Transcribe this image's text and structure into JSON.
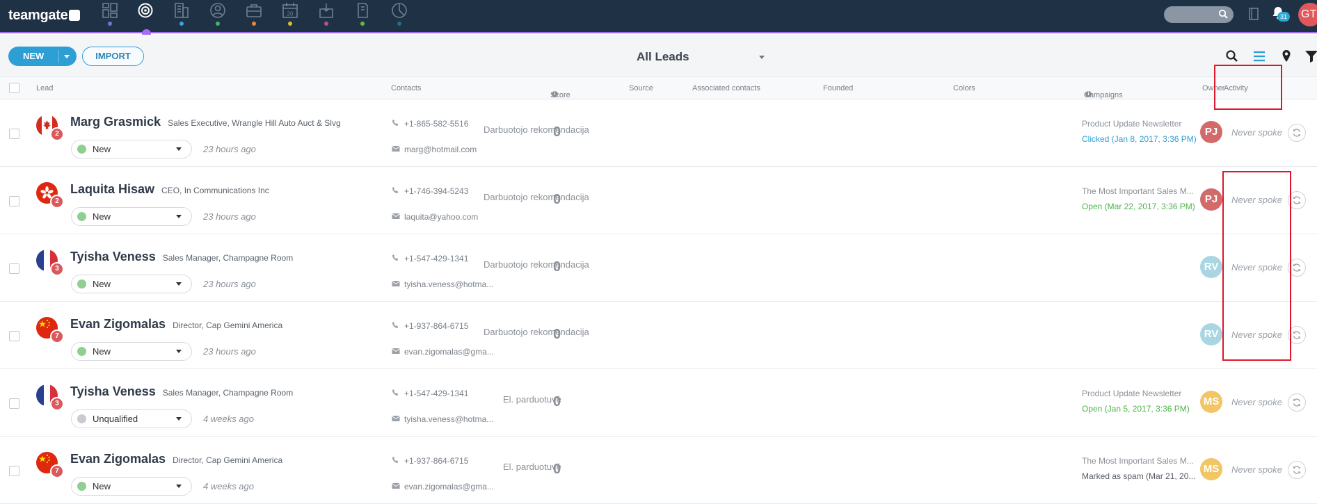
{
  "app": {
    "logo_text": "teamgate",
    "nav_items": [
      {
        "icon": "dashboard-icon",
        "dot_color": "#6a78d8"
      },
      {
        "icon": "leads-target-icon",
        "dot_color": "#a86cf2",
        "active": true
      },
      {
        "icon": "companies-building-icon",
        "dot_color": "#3aa5d8"
      },
      {
        "icon": "contacts-person-icon",
        "dot_color": "#43b36b"
      },
      {
        "icon": "deals-briefcase-icon",
        "dot_color": "#e8863a"
      },
      {
        "icon": "calendar-icon",
        "calendar_day": "20",
        "dot_color": "#d6c12a"
      },
      {
        "icon": "tasks-inbox-icon",
        "dot_color": "#c14e8a"
      },
      {
        "icon": "documents-icon",
        "dot_color": "#6ab83e"
      },
      {
        "icon": "reports-pie-icon",
        "dot_color": "#2a6a8a"
      }
    ],
    "notifications_count": "31",
    "user_initials": "GT"
  },
  "toolbar": {
    "new_label": "NEW",
    "import_label": "IMPORT",
    "view_label": "All Leads"
  },
  "columns": {
    "lead": "Lead",
    "contacts": "Contacts",
    "score": "Score",
    "source": "Source",
    "associated_contacts": "Associated contacts",
    "founded": "Founded",
    "colors": "Colors",
    "campaigns": "Campaigns",
    "owner": "Owner",
    "activity": "Activity"
  },
  "rows": [
    {
      "flag": "canada",
      "badge": "2",
      "name": "Marg Grasmick",
      "title": "Sales Executive, Wrangle Hill Auto Auct & Slvg",
      "status": "New",
      "status_color": "#8fd08f",
      "updated": "23 hours ago",
      "phone": "+1-865-582-5516",
      "email": "marg@hotmail.com",
      "score": "0",
      "source": "Darbuotojo rekomendacija",
      "campaign_name": "Product Update Newsletter",
      "campaign_status": "Clicked (Jan 8, 2017, 3:36 PM)",
      "campaign_color": "#2d9fd4",
      "owner": "PJ",
      "owner_color": "#d36a6a",
      "activity": "Never spoke"
    },
    {
      "flag": "hongkong",
      "badge": "2",
      "name": "Laquita Hisaw",
      "title": "CEO, In Communications Inc",
      "status": "New",
      "status_color": "#8fd08f",
      "updated": "23 hours ago",
      "phone": "+1-746-394-5243",
      "email": "laquita@yahoo.com",
      "score": "0",
      "source": "Darbuotojo rekomendacija",
      "campaign_name": "The Most Important Sales M...",
      "campaign_status": "Open (Mar 22, 2017, 3:36 PM)",
      "campaign_color": "#4cb34c",
      "owner": "PJ",
      "owner_color": "#d36a6a",
      "activity": "Never spoke"
    },
    {
      "flag": "france",
      "badge": "3",
      "name": "Tyisha Veness",
      "title": "Sales Manager, Champagne Room",
      "status": "New",
      "status_color": "#8fd08f",
      "updated": "23 hours ago",
      "phone": "+1-547-429-1341",
      "email": "tyisha.veness@hotma...",
      "score": "0",
      "source": "Darbuotojo rekomendacija",
      "campaign_name": "",
      "campaign_status": "",
      "campaign_color": "#8a9098",
      "owner": "RV",
      "owner_color": "#a9d6e2",
      "activity": "Never spoke"
    },
    {
      "flag": "china",
      "badge": "7",
      "name": "Evan Zigomalas",
      "title": "Director, Cap Gemini America",
      "status": "New",
      "status_color": "#8fd08f",
      "updated": "23 hours ago",
      "phone": "+1-937-864-6715",
      "email": "evan.zigomalas@gma...",
      "score": "0",
      "source": "Darbuotojo rekomendacija",
      "campaign_name": "",
      "campaign_status": "",
      "campaign_color": "#8a9098",
      "owner": "RV",
      "owner_color": "#a9d6e2",
      "activity": "Never spoke"
    },
    {
      "flag": "france",
      "badge": "3",
      "name": "Tyisha Veness",
      "title": "Sales Manager, Champagne Room",
      "status": "Unqualified",
      "status_color": "#c8cbcf",
      "updated": "4 weeks ago",
      "phone": "+1-547-429-1341",
      "email": "tyisha.veness@hotma...",
      "score": "0",
      "source": "El. parduotuvė",
      "campaign_name": "Product Update Newsletter",
      "campaign_status": "Open (Jan 5, 2017, 3:36 PM)",
      "campaign_color": "#4cb34c",
      "owner": "MS",
      "owner_color": "#f2c565",
      "activity": "Never spoke"
    },
    {
      "flag": "china",
      "badge": "7",
      "name": "Evan Zigomalas",
      "title": "Director, Cap Gemini America",
      "status": "New",
      "status_color": "#8fd08f",
      "updated": "4 weeks ago",
      "phone": "+1-937-864-6715",
      "email": "evan.zigomalas@gma...",
      "score": "0",
      "source": "El. parduotuvė",
      "campaign_name": "The Most Important Sales M...",
      "campaign_status": "Marked as spam (Mar 21, 20...",
      "campaign_color": "#555b63",
      "owner": "MS",
      "owner_color": "#f2c565",
      "activity": "Never spoke"
    }
  ]
}
